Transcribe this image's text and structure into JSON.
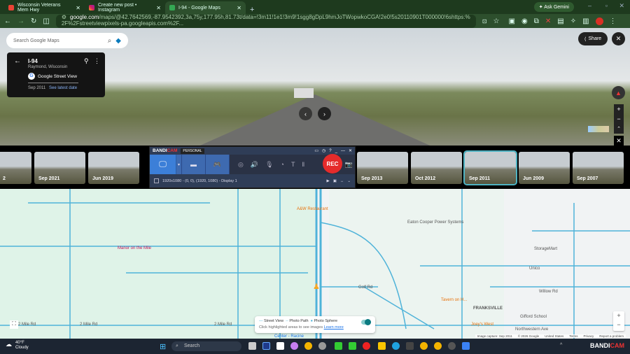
{
  "browser": {
    "tabs": [
      {
        "title": "Wisconsin Veterans Mem Hwy",
        "icon": "google-maps-icon"
      },
      {
        "title": "Create new post • Instagram",
        "icon": "instagram-icon"
      },
      {
        "title": "I-94 - Google Maps",
        "icon": "google-maps-icon",
        "active": true
      }
    ],
    "ask_gemini": "Ask Gemini",
    "url_host": "google.com",
    "url_path": "/maps/@42.7642569,-87.9542392,3a,75y,177.95h,81.73t/data=!3m11!1e1!3m9!1sgg8gDpL9hmJoTWopwkoCGA!2e0!5s20110901T000000!6shttps:%2F%2Fstreetviewpixels-pa.googleapis.com%2F..."
  },
  "maps": {
    "search_placeholder": "Search Google Maps",
    "place": {
      "title": "I-94",
      "subtitle": "Raymond, Wisconsin",
      "source": "Google Street View",
      "date": "Sep 2011",
      "latest_link": "See latest date"
    },
    "share_label": "Share",
    "timeline": [
      "2",
      "Sep 2021",
      "Jun 2019",
      "Sep 2013",
      "Oct 2012",
      "Sep 2011",
      "Jun 2009",
      "Sep 2007"
    ],
    "selected_date": "Sep 2011",
    "map_labels": {
      "aw": "A&W Restaurant",
      "eaton": "Eaton Cooper Power Systems",
      "storage": "StorageMart",
      "manor": "Manor on the Mile",
      "unico": "Unico",
      "golf": "Golf Rd",
      "tavern": "Tavern on H...",
      "franks": "FRANKSVILLE",
      "willow": "Willow Rd",
      "joeys": "Joey's West",
      "gifford": "Gifford School",
      "nw": "Northwestern Ave",
      "mile1": "2 Mile Rd",
      "mile2": "2 Mile Rd",
      "mile3": "2 Mile Rd",
      "center": "Center - Racine"
    },
    "legend": {
      "street_view": "Street View",
      "photo_path": "Photo Path",
      "photo_sphere": "Photo Sphere",
      "hint": "Click highlighted areas to see images",
      "learn": "Learn more"
    },
    "footer": [
      "Image capture: Sep 2011",
      "© 2026 Google",
      "United States",
      "Terms",
      "Privacy",
      "Report a problem"
    ]
  },
  "bandicam": {
    "brand_a": "BANDI",
    "brand_b": "CAM",
    "edition": "PERSONAL",
    "rec": "REC",
    "area": "1920x1080 - (0, 0), (1920, 1080) - Display 1"
  },
  "taskbar": {
    "temp": "40°F",
    "weather": "Cloudy",
    "search": "Search",
    "tray_brand_a": "BANDI",
    "tray_brand_b": "CAM"
  },
  "colors": {
    "accent": "#1a73e8",
    "rec": "#e52b2b",
    "coverage": "#4fb3d9"
  }
}
